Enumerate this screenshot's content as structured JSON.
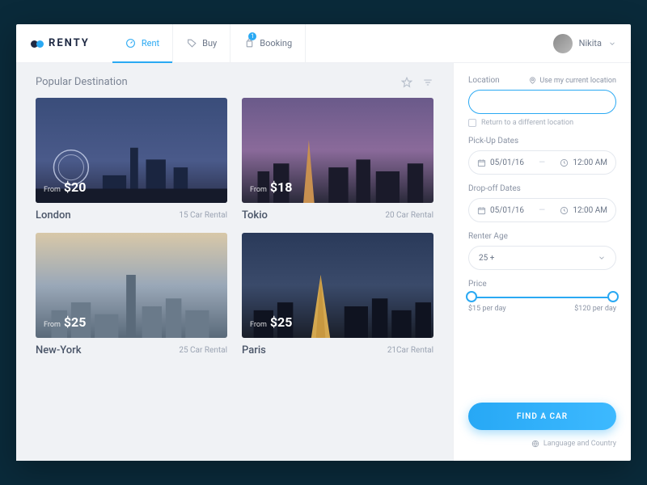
{
  "brand": "RENTY",
  "nav": {
    "rent": "Rent",
    "buy": "Buy",
    "booking": "Booking",
    "booking_badge": "1"
  },
  "user": {
    "name": "Nikita"
  },
  "section": {
    "title": "Popular Destination"
  },
  "cards": [
    {
      "city": "London",
      "from": "From",
      "price": "$20",
      "count": "15 Car Rental"
    },
    {
      "city": "Tokio",
      "from": "From",
      "price": "$18",
      "count": "20 Car Rental"
    },
    {
      "city": "New-York",
      "from": "From",
      "price": "$25",
      "count": "25 Car Rental"
    },
    {
      "city": "Paris",
      "from": "From",
      "price": "$25",
      "count": "21Car Rental"
    }
  ],
  "side": {
    "location_label": "Location",
    "use_current": "Use my current location",
    "location_value": "",
    "return_diff": "Return to a different location",
    "pickup_label": "Pick-Up Dates",
    "pickup_date": "05/01/16",
    "pickup_time": "12:00 AM",
    "dropoff_label": "Drop-off Dates",
    "dropoff_date": "05/01/16",
    "dropoff_time": "12:00 AM",
    "age_label": "Renter Age",
    "age_value": "25 +",
    "price_label": "Price",
    "price_min": "$15 per day",
    "price_max": "$120 per day",
    "cta": "FIND A CAR",
    "lang": "Language and Country"
  }
}
